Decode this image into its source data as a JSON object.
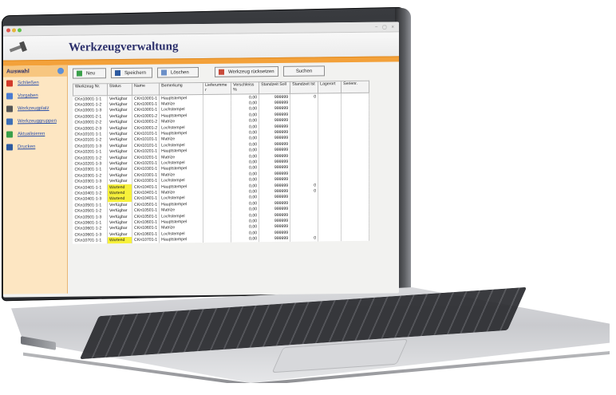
{
  "window": {
    "title_left": "● ● ●  ‹ ›",
    "controls": "− ▢ ×"
  },
  "app": {
    "title": "Werkzeugverwaltung"
  },
  "sidebar": {
    "heading": "Auswahl",
    "items": [
      {
        "label": "Schließen",
        "icon": "close-icon",
        "color": "#d23a2a"
      },
      {
        "label": "Vorgaben",
        "icon": "list-icon",
        "color": "#4a7bd0"
      },
      {
        "label": "Werkzeugplatz",
        "icon": "search-icon",
        "color": "#555555"
      },
      {
        "label": "Werkzeuggruppen",
        "icon": "group-icon",
        "color": "#3d6fb6"
      },
      {
        "label": "Aktualisieren",
        "icon": "refresh-icon",
        "color": "#3aa04a"
      },
      {
        "label": "Drucken",
        "icon": "print-icon",
        "color": "#2d5aa0"
      }
    ]
  },
  "toolbar": {
    "new_label": "Neu",
    "save_label": "Speichern",
    "delete_label": "Löschen",
    "reset_label": "Werkzeug rücksetzen",
    "search_label": "Suchen"
  },
  "table": {
    "columns": [
      "Werkzeug Nr.",
      "Status",
      "Name",
      "Bemerkung",
      "Lieferumme r",
      "Verschleiss %",
      "Standzeit Soll",
      "Standzeit Ist",
      "Lagerort",
      "Serienr."
    ],
    "rows": [
      [
        "CKn10001-1-1",
        "Verfügbar",
        "CKn10001-1",
        "Hauptstempel",
        "",
        "0,00",
        "999999",
        "0",
        "",
        ""
      ],
      [
        "CKn10001-1-2",
        "Verfügbar",
        "CKn10001-1",
        "Matrize",
        "",
        "0,00",
        "999999",
        "",
        "",
        ""
      ],
      [
        "CKn10001-1-3",
        "Verfügbar",
        "CKn10001-1",
        "Lochstempel",
        "",
        "0,00",
        "999999",
        "",
        "",
        ""
      ],
      [
        "CKn10001-2-1",
        "Verfügbar",
        "CKn10001-2",
        "Hauptstempel",
        "",
        "0,00",
        "999999",
        "",
        "",
        ""
      ],
      [
        "CKn10001-2-2",
        "Verfügbar",
        "CKn10001-2",
        "Matrize",
        "",
        "0,00",
        "999999",
        "",
        "",
        ""
      ],
      [
        "CKn10001-2-3",
        "Verfügbar",
        "CKn10001-2",
        "Lochstempel",
        "",
        "0,00",
        "999999",
        "",
        "",
        ""
      ],
      [
        "CKn10101-1-1",
        "Verfügbar",
        "CKn10101-1",
        "Hauptstempel",
        "",
        "0,00",
        "999999",
        "",
        "",
        ""
      ],
      [
        "CKn10101-1-2",
        "Verfügbar",
        "CKn10101-1",
        "Matrize",
        "",
        "0,00",
        "999999",
        "",
        "",
        ""
      ],
      [
        "CKn10101-1-3",
        "Verfügbar",
        "CKn10101-1",
        "Lochstempel",
        "",
        "0,00",
        "999999",
        "",
        "",
        ""
      ],
      [
        "CKn10201-1-1",
        "Verfügbar",
        "CKn10201-1",
        "Hauptstempel",
        "",
        "0,00",
        "999999",
        "",
        "",
        ""
      ],
      [
        "CKn10201-1-2",
        "Verfügbar",
        "CKn10201-1",
        "Matrize",
        "",
        "0,00",
        "999999",
        "",
        "",
        ""
      ],
      [
        "CKn10201-1-3",
        "Verfügbar",
        "CKn10201-1",
        "Lochstempel",
        "",
        "0,00",
        "999999",
        "",
        "",
        ""
      ],
      [
        "CKn10301-1-1",
        "Verfügbar",
        "CKn10301-1",
        "Hauptstempel",
        "",
        "0,00",
        "999999",
        "",
        "",
        ""
      ],
      [
        "CKn10301-1-2",
        "Verfügbar",
        "CKn10301-1",
        "Matrize",
        "",
        "0,00",
        "999999",
        "",
        "",
        ""
      ],
      [
        "CKn10301-1-3",
        "Verfügbar",
        "CKn10301-1",
        "Lochstempel",
        "",
        "0,00",
        "999999",
        "",
        "",
        ""
      ],
      [
        "CKn10401-1-1",
        "Wartend",
        "CKn10401-1",
        "Hauptstempel",
        "",
        "0,00",
        "999999",
        "0",
        "",
        ""
      ],
      [
        "CKn10401-1-2",
        "Wartend",
        "CKn10401-1",
        "Matrize",
        "",
        "0,00",
        "999999",
        "0",
        "",
        ""
      ],
      [
        "CKn10401-1-3",
        "Wartend",
        "CKn10401-1",
        "Lochstempel",
        "",
        "0,00",
        "999999",
        "",
        "",
        ""
      ],
      [
        "CKn10501-1-1",
        "Verfügbar",
        "CKn10501-1",
        "Hauptstempel",
        "",
        "0,00",
        "999999",
        "",
        "",
        ""
      ],
      [
        "CKn10501-1-2",
        "Verfügbar",
        "CKn10501-1",
        "Matrize",
        "",
        "0,00",
        "999999",
        "",
        "",
        ""
      ],
      [
        "CKn10501-1-3",
        "Verfügbar",
        "CKn10501-1",
        "Lochstempel",
        "",
        "0,00",
        "999999",
        "",
        "",
        ""
      ],
      [
        "CKn10601-1-1",
        "Verfügbar",
        "CKn10601-1",
        "Hauptstempel",
        "",
        "0,00",
        "999999",
        "",
        "",
        ""
      ],
      [
        "CKn10601-1-2",
        "Verfügbar",
        "CKn10601-1",
        "Matrize",
        "",
        "0,00",
        "999999",
        "",
        "",
        ""
      ],
      [
        "CKn10601-1-3",
        "Verfügbar",
        "CKn10601-1",
        "Lochstempel",
        "",
        "0,00",
        "999999",
        "",
        "",
        ""
      ],
      [
        "CKn10701-1-1",
        "Wartend",
        "CKn10701-1",
        "Hauptstempel",
        "",
        "0,00",
        "999999",
        "0",
        "",
        ""
      ]
    ]
  },
  "colors": {
    "accent": "#f3a13a",
    "sidebar": "#fde6c2",
    "title": "#2b2f6b",
    "wartend": "#f7f13a"
  }
}
